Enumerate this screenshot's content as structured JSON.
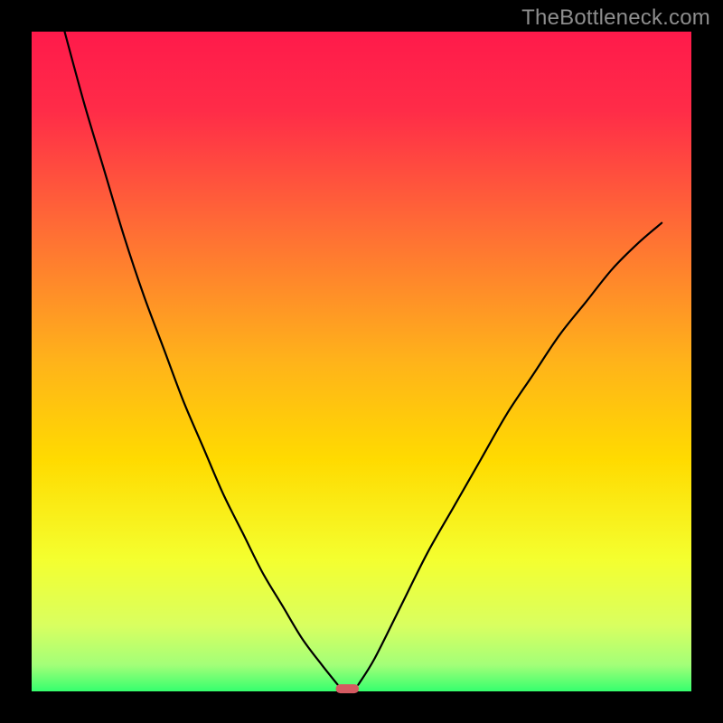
{
  "watermark": "TheBottleneck.com",
  "chart_data": {
    "type": "line",
    "title": "",
    "xlabel": "",
    "ylabel": "",
    "xlim": [
      0,
      100
    ],
    "ylim": [
      0,
      100
    ],
    "grid": false,
    "legend": false,
    "series": [
      {
        "name": "left-curve",
        "x": [
          5,
          8,
          11,
          14,
          17,
          20,
          23,
          26,
          29,
          32,
          35,
          38,
          41,
          44,
          46.4
        ],
        "y": [
          100,
          89,
          79,
          69,
          60,
          52,
          44,
          37,
          30,
          24,
          18,
          13,
          8,
          4,
          1
        ]
      },
      {
        "name": "right-curve",
        "x": [
          49.5,
          52,
          56,
          60,
          64,
          68,
          72,
          76,
          80,
          84,
          88,
          92,
          95.5
        ],
        "y": [
          1,
          5,
          13,
          21,
          28,
          35,
          42,
          48,
          54,
          59,
          64,
          68,
          71
        ]
      },
      {
        "name": "valley-marker",
        "x": [
          46.1,
          49.6
        ],
        "y": [
          0.4,
          0.4
        ]
      }
    ],
    "colors": {
      "plot_bg_gradient": [
        "#ff1a4b",
        "#ffdb00",
        "#ebff61",
        "#35ff6e"
      ],
      "curve": "#000000",
      "marker": "#d45a61",
      "frame": "#000000"
    },
    "notes": "Image is a bottleneck V-curve on a red→green vertical gradient. Axes have no numeric labels; values are estimated as percentages of plot width/height."
  }
}
